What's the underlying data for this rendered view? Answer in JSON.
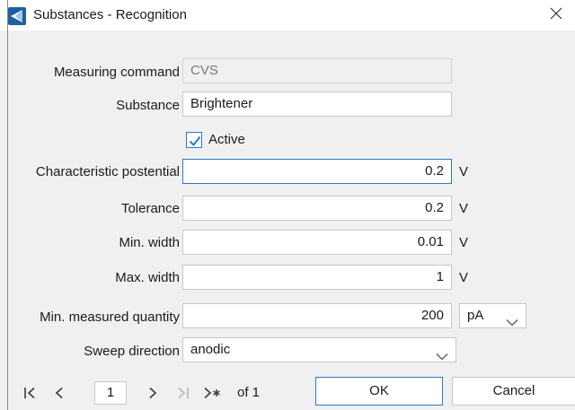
{
  "window": {
    "title": "Substances - Recognition",
    "close_glyph": "×"
  },
  "form": {
    "measuring_command": {
      "label": "Measuring command",
      "value": "CVS"
    },
    "substance": {
      "label": "Substance",
      "value": "Brightener"
    },
    "active": {
      "label": "Active",
      "checked": true
    },
    "characteristic_potential": {
      "label": "Characteristic postential",
      "value": "0.2",
      "unit": "V"
    },
    "tolerance": {
      "label": "Tolerance",
      "value": "0.2",
      "unit": "V"
    },
    "min_width": {
      "label": "Min. width",
      "value": "0.01",
      "unit": "V"
    },
    "max_width": {
      "label": "Max. width",
      "value": "1",
      "unit": "V"
    },
    "min_measured_quantity": {
      "label": "Min. measured quantity",
      "value": "200",
      "unit_selected": "pA"
    },
    "sweep_direction": {
      "label": "Sweep direction",
      "selected": "anodic"
    }
  },
  "navigator": {
    "current_page": "1",
    "of_text": "of 1"
  },
  "buttons": {
    "ok": "OK",
    "cancel": "Cancel"
  },
  "colors": {
    "accent": "#2b79c9",
    "background": "#f0f0f0"
  },
  "icons": {
    "app": "app-logo-icon",
    "close": "close-icon",
    "check": "checkmark-icon",
    "dropdown": "chevron-down-icon",
    "first": "first-record-icon",
    "prev": "previous-record-icon",
    "next": "next-record-icon",
    "last": "last-record-icon",
    "new": "new-record-icon"
  }
}
